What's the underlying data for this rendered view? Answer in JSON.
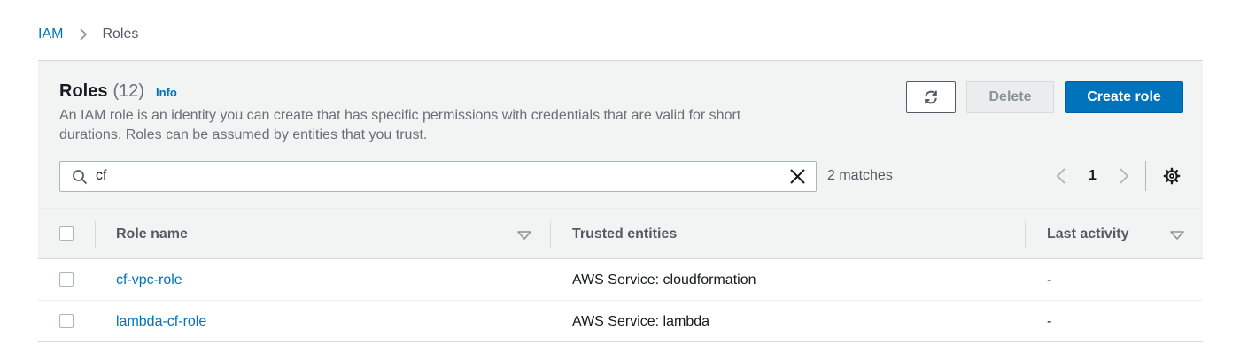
{
  "breadcrumb": {
    "root": "IAM",
    "current": "Roles"
  },
  "header": {
    "title": "Roles",
    "count": "(12)",
    "info": "Info",
    "description": "An IAM role is an identity you can create that has specific permissions with credentials that are valid for short durations. Roles can be assumed by entities that you trust."
  },
  "actions": {
    "delete_label": "Delete",
    "create_label": "Create role",
    "refresh_icon": "refresh-icon"
  },
  "search": {
    "value": "cf",
    "matches": "2 matches"
  },
  "pagination": {
    "current_page": "1"
  },
  "table": {
    "columns": [
      "Role name",
      "Trusted entities",
      "Last activity"
    ],
    "rows": [
      {
        "role_name": "cf-vpc-role",
        "trusted_entities": "AWS Service: cloudformation",
        "last_activity": "-"
      },
      {
        "role_name": "lambda-cf-role",
        "trusted_entities": "AWS Service: lambda",
        "last_activity": "-"
      }
    ]
  },
  "colors": {
    "accent": "#0073bb",
    "header_bg": "#f2f3f3",
    "text": "#16191f",
    "muted": "#687078"
  }
}
